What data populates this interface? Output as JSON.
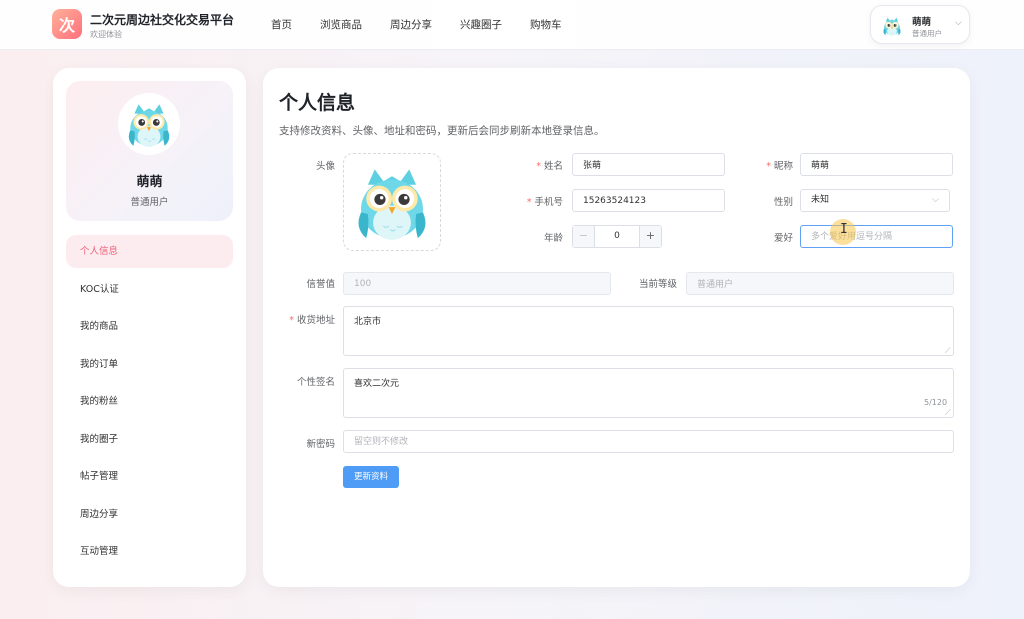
{
  "header": {
    "logo_char": "次",
    "title": "二次元周边社交化交易平台",
    "subtitle": "欢迎体验",
    "nav": [
      "首页",
      "浏览商品",
      "周边分享",
      "兴趣圈子",
      "购物车"
    ],
    "user": {
      "name": "萌萌",
      "role": "普通用户",
      "caret": "⌵"
    }
  },
  "sidebar": {
    "name": "萌萌",
    "role": "普通用户",
    "menu": [
      "个人信息",
      "KOC认证",
      "我的商品",
      "我的订单",
      "我的粉丝",
      "我的圈子",
      "帖子管理",
      "周边分享",
      "互动管理"
    ]
  },
  "main": {
    "title": "个人信息",
    "description": "支持修改资料、头像、地址和密码，更新后会同步刷新本地登录信息。",
    "labels": {
      "avatar": "头像",
      "name": "姓名",
      "nickname": "昵称",
      "phone": "手机号",
      "gender": "性别",
      "age": "年龄",
      "hobby": "爱好",
      "credit": "信誉值",
      "level": "当前等级",
      "address": "收货地址",
      "signature": "个性签名",
      "password": "新密码"
    },
    "required_mark": "*",
    "values": {
      "name": "张萌",
      "nickname": "萌萌",
      "phone": "15263524123",
      "gender": "未知",
      "age": "0",
      "credit": "100",
      "level": "普通用户",
      "address": "北京市",
      "signature": "喜欢二次元"
    },
    "placeholders": {
      "hobby": "多个爱好用逗号分隔",
      "password": "留空则不修改"
    },
    "signature_counter": "5/120",
    "stepper": {
      "minus": "−",
      "plus": "+"
    },
    "gender_caret": "⌵",
    "submit_label": "更新资料"
  },
  "colors": {
    "accent": "#ec5f78",
    "primary": "#4e9cf6",
    "required": "#f56c6c"
  },
  "icons": {
    "avatar": "owl-avatar-icon",
    "cursor": "text-cursor-icon"
  }
}
